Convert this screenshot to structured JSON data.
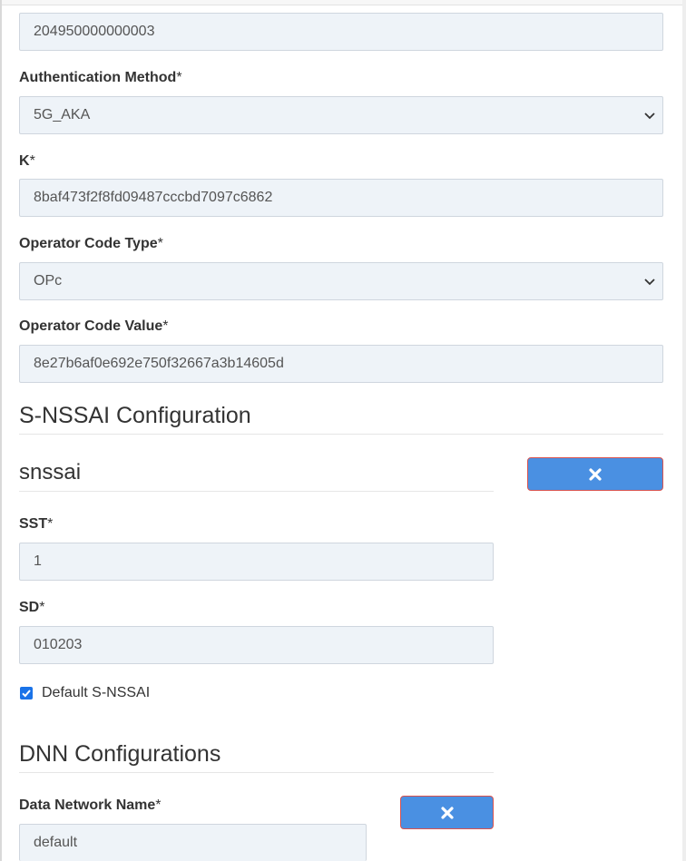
{
  "subscriber": {
    "supi_value": "204950000000003",
    "auth_method_label": "Authentication Method",
    "auth_method_value": "5G_AKA",
    "k_label": "K",
    "k_value": "8baf473f2f8fd09487cccbd7097c6862",
    "op_type_label": "Operator Code Type",
    "op_type_value": "OPc",
    "op_value_label": "Operator Code Value",
    "op_value_value": "8e27b6af0e692e750f32667a3b14605d",
    "required_mark": "*"
  },
  "snssai_section": {
    "title": "S-NSSAI Configuration",
    "item_title": "snssai",
    "sst_label": "SST",
    "sst_value": "1",
    "sd_label": "SD",
    "sd_value": "010203",
    "default_label": "Default S-NSSAI",
    "default_checked": true
  },
  "dnn_section": {
    "title": "DNN Configurations",
    "dnn_label": "Data Network Name",
    "dnn_value": "default"
  },
  "colors": {
    "button_bg": "#4a90e2",
    "button_border": "#d9534f",
    "input_bg": "#eef3f8",
    "checkbox": "#1a73e8"
  },
  "icons": {
    "delete_icon": "x-icon",
    "select_icon": "chevron-down-icon"
  }
}
